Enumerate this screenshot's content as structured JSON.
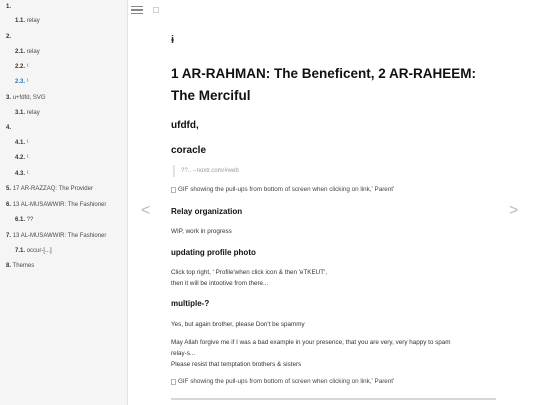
{
  "toc": [
    {
      "num": "1.",
      "label": ""
    },
    {
      "num": "1.1.",
      "label": "relay"
    },
    {
      "num": "2.",
      "label": ""
    },
    {
      "num": "2.1.",
      "label": "relay"
    },
    {
      "num": "2.2.",
      "label": "¹"
    },
    {
      "num": "2.3.",
      "label": "¹"
    },
    {
      "num": "3.",
      "label": "u+fdfd, SVG"
    },
    {
      "num": "3.1.",
      "label": "relay"
    },
    {
      "num": "4.",
      "label": ""
    },
    {
      "num": "4.1.",
      "label": "¹"
    },
    {
      "num": "4.2.",
      "label": "¹"
    },
    {
      "num": "4.3.",
      "label": "¹"
    },
    {
      "num": "5.",
      "label": "17 AR-RAZZAQ: The Provider"
    },
    {
      "num": "6.",
      "label": "13 AL-MUSAWWIR: The Fashioner"
    },
    {
      "num": "6.1.",
      "label": "??"
    },
    {
      "num": "7.",
      "label": "13 AL-MUSAWWIR: The Fashioner"
    },
    {
      "num": "7.1.",
      "label": "occur-[...]"
    },
    {
      "num": "8.",
      "label": "Themes"
    }
  ],
  "nav": {
    "prev": "<",
    "next": ">"
  },
  "content": {
    "glyph": "ɨ",
    "title_line1": "1 AR-RAHMAN: The Beneficent, 2 AR-RAHEEM:",
    "title_line2": "The Merciful",
    "h2_a": "ufdfd,",
    "h2_b": "coracle",
    "quote": "??.. --noxtr.com/#web",
    "gif_alt": "GIF showing the pull-ups from bottom of screen when clicking on link,' Parent'",
    "h3_relay": "Relay organization",
    "p_wip": "WIP, work in progress",
    "h3_profile": "updating profile photo",
    "p_click_1": "Click top right, ' Profile'when click icon & then 'eTKEUT',",
    "p_click_2": "then it will be intootive from there...",
    "h3_multiple": "multiple-?",
    "p_yes": "Yes, but again brother, please Don't be spammy",
    "p_may_1": "May Allah forgive me if I was a bad example in your presence, that you are very, very happy to spam",
    "p_may_2": "relay-s...",
    "p_please": "Please resist that temptation brothers & sisters",
    "gif_alt_2": "GIF showing the pull-ups from bottom of screen when clicking on link,' Parent'"
  }
}
